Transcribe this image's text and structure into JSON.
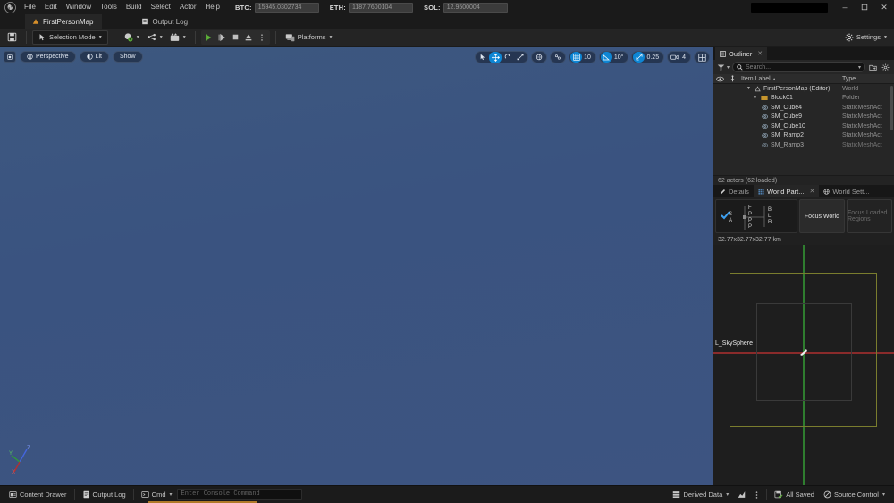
{
  "window": {
    "menus": [
      "File",
      "Edit",
      "Window",
      "Tools",
      "Build",
      "Select",
      "Actor",
      "Help"
    ],
    "crypto": [
      {
        "label": "BTC:",
        "value": "15945.0302734"
      },
      {
        "label": "ETH:",
        "value": "1187.7600104"
      },
      {
        "label": "SOL:",
        "value": "12.9500004"
      }
    ],
    "controls": {
      "minimize": "–",
      "maximize": "❐",
      "close": "✕"
    }
  },
  "tabs": [
    {
      "label": "FirstPersonMap",
      "icon": "level-icon",
      "active": true
    },
    {
      "label": "Output Log",
      "icon": "log-icon",
      "active": false
    }
  ],
  "toolbar": {
    "save_label": "Save",
    "mode_label": "Selection Mode",
    "add_label": "Add",
    "blueprints_label": "Blueprints",
    "cinematics_label": "Cinematics",
    "play_label": "Play",
    "skip_label": "Skip",
    "stop_label": "Stop",
    "eject_label": "Eject",
    "more_label": "More Options",
    "platforms_label": "Platforms",
    "settings_label": "Settings"
  },
  "viewport": {
    "left_controls": [
      {
        "name": "viewport-options",
        "label": ""
      },
      {
        "name": "view-perspective",
        "label": "Perspective"
      },
      {
        "name": "view-mode-lit",
        "label": "Lit"
      },
      {
        "name": "show-flags",
        "label": "Show"
      }
    ],
    "transform_tools": [
      {
        "name": "select-tool",
        "active": false
      },
      {
        "name": "move-tool",
        "active": true
      },
      {
        "name": "rotate-tool",
        "active": false
      },
      {
        "name": "scale-tool",
        "active": false
      }
    ],
    "coordinate_tools": [
      {
        "name": "world-coordinate-toggle",
        "active": false
      },
      {
        "name": "surface-snap-toggle",
        "active": false
      }
    ],
    "grid_snap": {
      "enabled": true,
      "value": "10"
    },
    "angle_snap": {
      "enabled": true,
      "value": "10°"
    },
    "scale_snap": {
      "enabled": true,
      "value": "0.25"
    },
    "camera_speed": {
      "value": "4"
    },
    "layout_label": "Viewport Layout"
  },
  "outliner": {
    "tab_label": "Outliner",
    "search_placeholder": "Search...",
    "columns": {
      "eye": "visibility",
      "pin": "pin",
      "label": "Item Label",
      "type": "Type"
    },
    "sort_indicator": "▲",
    "rows": [
      {
        "label": "FirstPersonMap (Editor)",
        "type": "World",
        "indent": 1,
        "icon": "world-icon",
        "twisty": "▼"
      },
      {
        "label": "Block01",
        "type": "Folder",
        "indent": 2,
        "icon": "folder-icon",
        "twisty": "▼"
      },
      {
        "label": "SM_Cube4",
        "type": "StaticMeshAct",
        "indent": 3,
        "icon": "mesh-icon",
        "twisty": ""
      },
      {
        "label": "SM_Cube9",
        "type": "StaticMeshAct",
        "indent": 3,
        "icon": "mesh-icon",
        "twisty": ""
      },
      {
        "label": "SM_Cube10",
        "type": "StaticMeshAct",
        "indent": 3,
        "icon": "mesh-icon",
        "twisty": ""
      },
      {
        "label": "SM_Ramp2",
        "type": "StaticMeshAct",
        "indent": 3,
        "icon": "mesh-icon",
        "twisty": ""
      },
      {
        "label": "SM_Ramp3",
        "type": "StaticMeshAct",
        "indent": 3,
        "icon": "mesh-icon",
        "twisty": ""
      }
    ],
    "status": "62 actors (62 loaded)"
  },
  "details_dock": {
    "tabs": [
      {
        "label": "Details",
        "icon": "details-icon",
        "active": false,
        "closable": false
      },
      {
        "label": "World Part...",
        "icon": "world-partition-icon",
        "active": true,
        "closable": true
      },
      {
        "label": "World Sett...",
        "icon": "world-settings-icon",
        "active": false,
        "closable": false
      }
    ]
  },
  "world_partition": {
    "direction_widget": {
      "checked": true,
      "labels": [
        "F",
        "B",
        "S",
        "P",
        "L",
        "A",
        "P",
        "R",
        "P"
      ]
    },
    "focus_world_label": "Focus World",
    "focus_loaded_regions_label": "Focus Loaded Regions",
    "scale_label": "32.77x32.77x32.77 km",
    "minimap": {
      "actor_label": "L_SkySphere",
      "axis_x_color": "#8a2b2b",
      "axis_y_color": "#2f7d2f",
      "bounds_color": "#7a7d2e"
    }
  },
  "statusbar": {
    "left": [
      {
        "label": "Content Drawer",
        "icon": "drawer-icon"
      },
      {
        "label": "Output Log",
        "icon": "log-icon"
      },
      {
        "label": "Cmd",
        "icon": "cmd-icon",
        "caret": true
      }
    ],
    "console_placeholder": "Enter Console Command",
    "right": [
      {
        "label": "Derived Data",
        "icon": "derived-data-icon"
      },
      {
        "label": "",
        "icon": "stats-icon"
      },
      {
        "label": "",
        "icon": "overflow-icon"
      },
      {
        "label": "All Saved",
        "icon": "saved-icon"
      },
      {
        "label": "Source Control",
        "icon": "source-control-icon"
      }
    ]
  },
  "colors": {
    "accent_blue": "#0e86d4",
    "viewport_bg": "#3a5380",
    "play_green": "#5cb338",
    "notification": "#b07a28"
  }
}
